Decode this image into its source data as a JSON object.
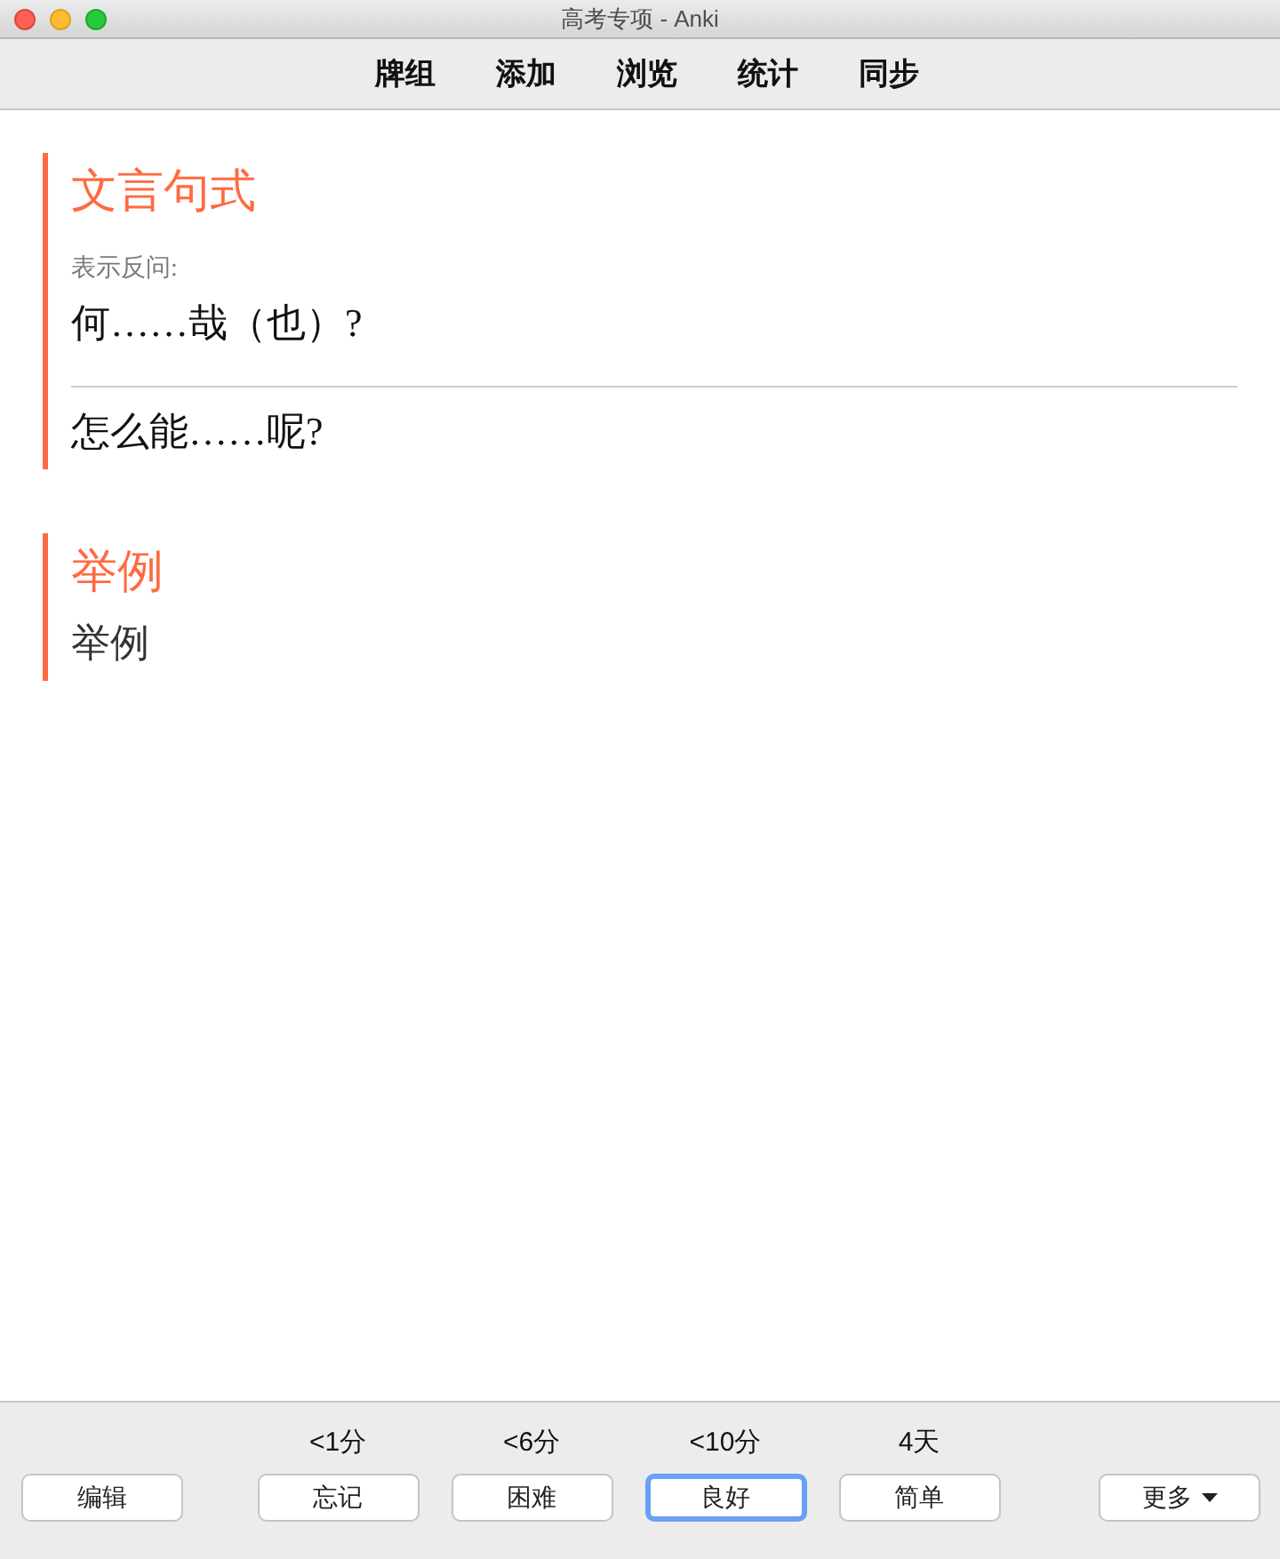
{
  "window": {
    "title": "高考专项 - Anki"
  },
  "toolbar": [
    {
      "label": "牌组"
    },
    {
      "label": "添加"
    },
    {
      "label": "浏览"
    },
    {
      "label": "统计"
    },
    {
      "label": "同步"
    }
  ],
  "card": {
    "sections": [
      {
        "heading": "文言句式",
        "blocks": [
          {
            "kind": "hint",
            "text": "表示反问:"
          },
          {
            "kind": "front",
            "text": "何……哉（也）?"
          },
          {
            "kind": "divider"
          },
          {
            "kind": "answer",
            "text": "怎么能……呢?"
          }
        ]
      },
      {
        "heading": "举例",
        "blocks": [
          {
            "kind": "plain",
            "text": "举例"
          }
        ]
      }
    ]
  },
  "bottom_bar": {
    "edit_button": "编辑",
    "answers": [
      {
        "interval": "<1分",
        "label": "忘记",
        "selected": false
      },
      {
        "interval": "<6分",
        "label": "困难",
        "selected": false
      },
      {
        "interval": "<10分",
        "label": "良好",
        "selected": true
      },
      {
        "interval": "4天",
        "label": "简单",
        "selected": false
      }
    ],
    "more_button": "更多"
  }
}
